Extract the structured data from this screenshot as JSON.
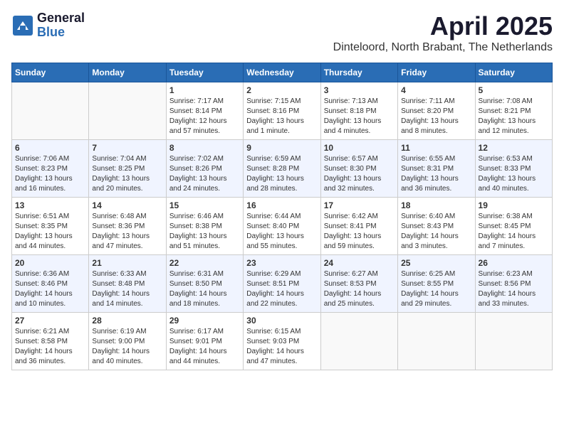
{
  "header": {
    "logo_general": "General",
    "logo_blue": "Blue",
    "month_year": "April 2025",
    "location": "Dinteloord, North Brabant, The Netherlands"
  },
  "weekdays": [
    "Sunday",
    "Monday",
    "Tuesday",
    "Wednesday",
    "Thursday",
    "Friday",
    "Saturday"
  ],
  "weeks": [
    [
      {
        "day": "",
        "info": ""
      },
      {
        "day": "",
        "info": ""
      },
      {
        "day": "1",
        "info": "Sunrise: 7:17 AM\nSunset: 8:14 PM\nDaylight: 12 hours\nand 57 minutes."
      },
      {
        "day": "2",
        "info": "Sunrise: 7:15 AM\nSunset: 8:16 PM\nDaylight: 13 hours\nand 1 minute."
      },
      {
        "day": "3",
        "info": "Sunrise: 7:13 AM\nSunset: 8:18 PM\nDaylight: 13 hours\nand 4 minutes."
      },
      {
        "day": "4",
        "info": "Sunrise: 7:11 AM\nSunset: 8:20 PM\nDaylight: 13 hours\nand 8 minutes."
      },
      {
        "day": "5",
        "info": "Sunrise: 7:08 AM\nSunset: 8:21 PM\nDaylight: 13 hours\nand 12 minutes."
      }
    ],
    [
      {
        "day": "6",
        "info": "Sunrise: 7:06 AM\nSunset: 8:23 PM\nDaylight: 13 hours\nand 16 minutes."
      },
      {
        "day": "7",
        "info": "Sunrise: 7:04 AM\nSunset: 8:25 PM\nDaylight: 13 hours\nand 20 minutes."
      },
      {
        "day": "8",
        "info": "Sunrise: 7:02 AM\nSunset: 8:26 PM\nDaylight: 13 hours\nand 24 minutes."
      },
      {
        "day": "9",
        "info": "Sunrise: 6:59 AM\nSunset: 8:28 PM\nDaylight: 13 hours\nand 28 minutes."
      },
      {
        "day": "10",
        "info": "Sunrise: 6:57 AM\nSunset: 8:30 PM\nDaylight: 13 hours\nand 32 minutes."
      },
      {
        "day": "11",
        "info": "Sunrise: 6:55 AM\nSunset: 8:31 PM\nDaylight: 13 hours\nand 36 minutes."
      },
      {
        "day": "12",
        "info": "Sunrise: 6:53 AM\nSunset: 8:33 PM\nDaylight: 13 hours\nand 40 minutes."
      }
    ],
    [
      {
        "day": "13",
        "info": "Sunrise: 6:51 AM\nSunset: 8:35 PM\nDaylight: 13 hours\nand 44 minutes."
      },
      {
        "day": "14",
        "info": "Sunrise: 6:48 AM\nSunset: 8:36 PM\nDaylight: 13 hours\nand 47 minutes."
      },
      {
        "day": "15",
        "info": "Sunrise: 6:46 AM\nSunset: 8:38 PM\nDaylight: 13 hours\nand 51 minutes."
      },
      {
        "day": "16",
        "info": "Sunrise: 6:44 AM\nSunset: 8:40 PM\nDaylight: 13 hours\nand 55 minutes."
      },
      {
        "day": "17",
        "info": "Sunrise: 6:42 AM\nSunset: 8:41 PM\nDaylight: 13 hours\nand 59 minutes."
      },
      {
        "day": "18",
        "info": "Sunrise: 6:40 AM\nSunset: 8:43 PM\nDaylight: 14 hours\nand 3 minutes."
      },
      {
        "day": "19",
        "info": "Sunrise: 6:38 AM\nSunset: 8:45 PM\nDaylight: 14 hours\nand 7 minutes."
      }
    ],
    [
      {
        "day": "20",
        "info": "Sunrise: 6:36 AM\nSunset: 8:46 PM\nDaylight: 14 hours\nand 10 minutes."
      },
      {
        "day": "21",
        "info": "Sunrise: 6:33 AM\nSunset: 8:48 PM\nDaylight: 14 hours\nand 14 minutes."
      },
      {
        "day": "22",
        "info": "Sunrise: 6:31 AM\nSunset: 8:50 PM\nDaylight: 14 hours\nand 18 minutes."
      },
      {
        "day": "23",
        "info": "Sunrise: 6:29 AM\nSunset: 8:51 PM\nDaylight: 14 hours\nand 22 minutes."
      },
      {
        "day": "24",
        "info": "Sunrise: 6:27 AM\nSunset: 8:53 PM\nDaylight: 14 hours\nand 25 minutes."
      },
      {
        "day": "25",
        "info": "Sunrise: 6:25 AM\nSunset: 8:55 PM\nDaylight: 14 hours\nand 29 minutes."
      },
      {
        "day": "26",
        "info": "Sunrise: 6:23 AM\nSunset: 8:56 PM\nDaylight: 14 hours\nand 33 minutes."
      }
    ],
    [
      {
        "day": "27",
        "info": "Sunrise: 6:21 AM\nSunset: 8:58 PM\nDaylight: 14 hours\nand 36 minutes."
      },
      {
        "day": "28",
        "info": "Sunrise: 6:19 AM\nSunset: 9:00 PM\nDaylight: 14 hours\nand 40 minutes."
      },
      {
        "day": "29",
        "info": "Sunrise: 6:17 AM\nSunset: 9:01 PM\nDaylight: 14 hours\nand 44 minutes."
      },
      {
        "day": "30",
        "info": "Sunrise: 6:15 AM\nSunset: 9:03 PM\nDaylight: 14 hours\nand 47 minutes."
      },
      {
        "day": "",
        "info": ""
      },
      {
        "day": "",
        "info": ""
      },
      {
        "day": "",
        "info": ""
      }
    ]
  ]
}
